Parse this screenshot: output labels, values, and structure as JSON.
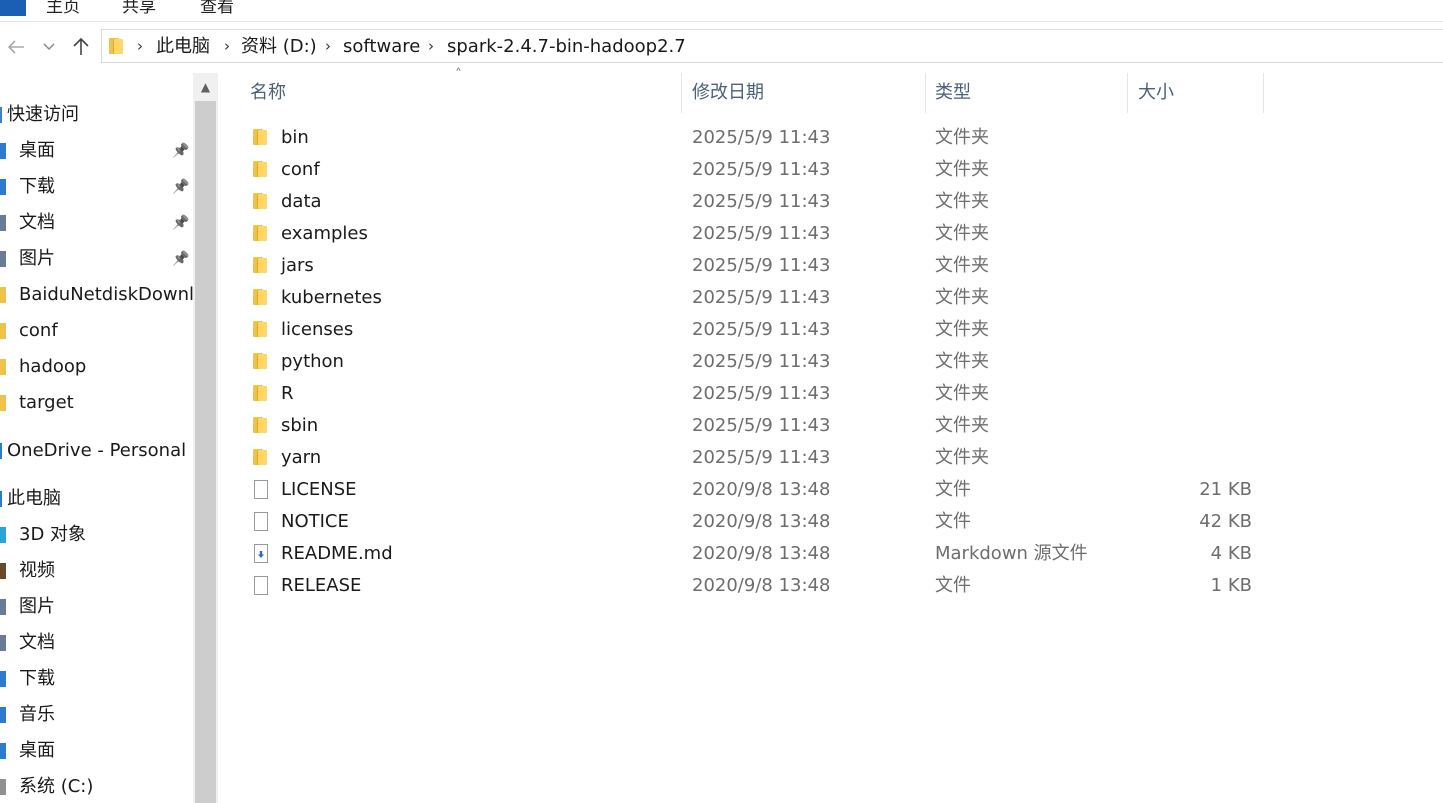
{
  "ribbon": {
    "tabs": [
      "主页",
      "共享",
      "查看"
    ]
  },
  "address": {
    "crumbs": [
      "此电脑",
      "资料 (D:)",
      "software",
      "spark-2.4.7-bin-hadoop2.7"
    ]
  },
  "sidebar": {
    "items": [
      {
        "label": "快速访问",
        "icon": "star-icon",
        "root": true
      },
      {
        "label": "桌面",
        "icon": "desktop-icon",
        "pinned": true
      },
      {
        "label": "下载",
        "icon": "download-icon",
        "pinned": true
      },
      {
        "label": "文档",
        "icon": "document-icon",
        "pinned": true
      },
      {
        "label": "图片",
        "icon": "picture-icon",
        "pinned": true
      },
      {
        "label": "BaiduNetdiskDownlo",
        "icon": "folder-icon"
      },
      {
        "label": "conf",
        "icon": "folder-icon"
      },
      {
        "label": "hadoop",
        "icon": "folder-icon"
      },
      {
        "label": "target",
        "icon": "folder-icon"
      },
      {
        "label": "OneDrive - Personal",
        "icon": "cloud-icon",
        "root": true
      },
      {
        "label": "此电脑",
        "icon": "computer-icon",
        "root": true
      },
      {
        "label": "3D 对象",
        "icon": "cube-icon"
      },
      {
        "label": "视频",
        "icon": "video-icon"
      },
      {
        "label": "图片",
        "icon": "picture-icon"
      },
      {
        "label": "文档",
        "icon": "document-icon"
      },
      {
        "label": "下载",
        "icon": "download-icon"
      },
      {
        "label": "音乐",
        "icon": "music-icon"
      },
      {
        "label": "桌面",
        "icon": "desktop-icon"
      },
      {
        "label": "系统 (C:)",
        "icon": "drive-icon"
      }
    ]
  },
  "columns": {
    "name": "名称",
    "date": "修改日期",
    "type": "类型",
    "size": "大小"
  },
  "files": [
    {
      "name": "bin",
      "date": "2025/5/9 11:43",
      "type": "文件夹",
      "size": "",
      "kind": "folder"
    },
    {
      "name": "conf",
      "date": "2025/5/9 11:43",
      "type": "文件夹",
      "size": "",
      "kind": "folder"
    },
    {
      "name": "data",
      "date": "2025/5/9 11:43",
      "type": "文件夹",
      "size": "",
      "kind": "folder"
    },
    {
      "name": "examples",
      "date": "2025/5/9 11:43",
      "type": "文件夹",
      "size": "",
      "kind": "folder"
    },
    {
      "name": "jars",
      "date": "2025/5/9 11:43",
      "type": "文件夹",
      "size": "",
      "kind": "folder"
    },
    {
      "name": "kubernetes",
      "date": "2025/5/9 11:43",
      "type": "文件夹",
      "size": "",
      "kind": "folder"
    },
    {
      "name": "licenses",
      "date": "2025/5/9 11:43",
      "type": "文件夹",
      "size": "",
      "kind": "folder"
    },
    {
      "name": "python",
      "date": "2025/5/9 11:43",
      "type": "文件夹",
      "size": "",
      "kind": "folder"
    },
    {
      "name": "R",
      "date": "2025/5/9 11:43",
      "type": "文件夹",
      "size": "",
      "kind": "folder"
    },
    {
      "name": "sbin",
      "date": "2025/5/9 11:43",
      "type": "文件夹",
      "size": "",
      "kind": "folder"
    },
    {
      "name": "yarn",
      "date": "2025/5/9 11:43",
      "type": "文件夹",
      "size": "",
      "kind": "folder"
    },
    {
      "name": "LICENSE",
      "date": "2020/9/8 13:48",
      "type": "文件",
      "size": "21 KB",
      "kind": "file"
    },
    {
      "name": "NOTICE",
      "date": "2020/9/8 13:48",
      "type": "文件",
      "size": "42 KB",
      "kind": "file"
    },
    {
      "name": "README.md",
      "date": "2020/9/8 13:48",
      "type": "Markdown 源文件",
      "size": "4 KB",
      "kind": "markdown"
    },
    {
      "name": "RELEASE",
      "date": "2020/9/8 13:48",
      "type": "文件",
      "size": "1 KB",
      "kind": "file"
    }
  ]
}
